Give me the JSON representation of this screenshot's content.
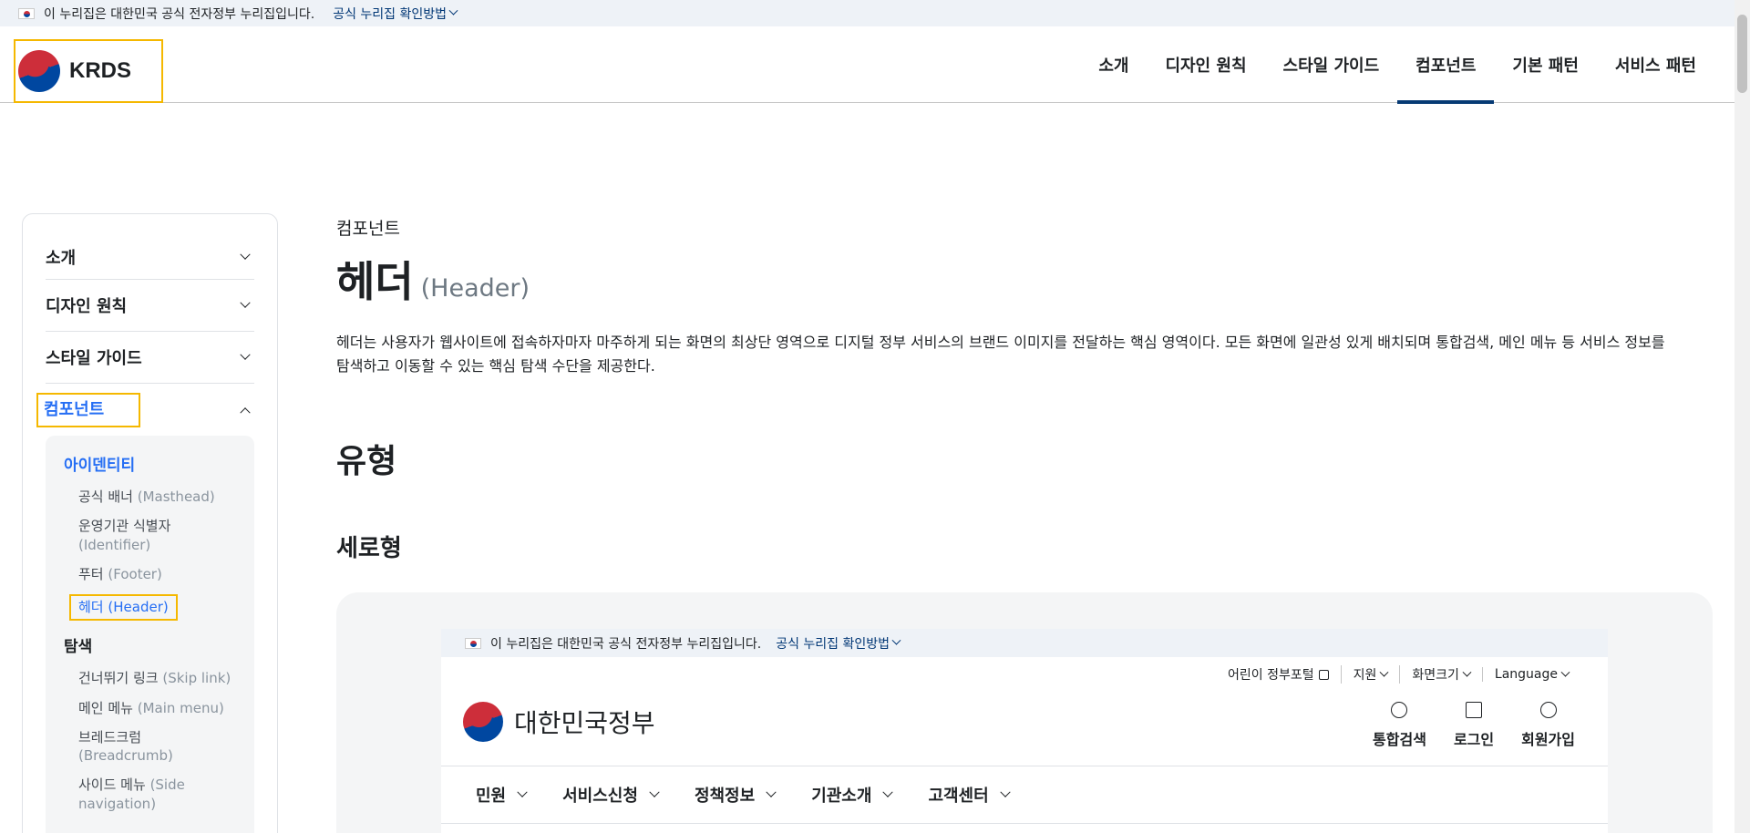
{
  "masthead": {
    "text": "이 누리집은 대한민국 공식 전자정부 누리집입니다.",
    "link": "공식 누리집 확인방법"
  },
  "header": {
    "logo_text": "KRDS",
    "nav": [
      "소개",
      "디자인 원칙",
      "스타일 가이드",
      "컴포넌트",
      "기본 패턴",
      "서비스 패턴"
    ],
    "active_nav": "컴포넌트"
  },
  "sidebar": {
    "sections": [
      "소개",
      "디자인 원칙",
      "스타일 가이드",
      "컴포넌트"
    ],
    "group1": "아이덴티티",
    "identity_items": [
      {
        "ko": "공식 배너",
        "en": "(Masthead)"
      },
      {
        "ko": "운영기관 식별자",
        "en": "(Identifier)"
      },
      {
        "ko": "푸터",
        "en": "(Footer)"
      },
      {
        "ko": "헤더",
        "en": "(Header)"
      }
    ],
    "group2": "탐색",
    "nav_items": [
      {
        "ko": "건너뛰기 링크",
        "en": "(Skip link)"
      },
      {
        "ko": "메인 메뉴",
        "en": "(Main menu)"
      },
      {
        "ko": "브레드크럼",
        "en": "(Breadcrumb)"
      },
      {
        "ko": "사이드 메뉴",
        "en": "(Side navigation)"
      }
    ]
  },
  "main": {
    "breadcrumb": "컴포넌트",
    "title": "헤더",
    "title_en": "(Header)",
    "description": "헤더는 사용자가 웹사이트에 접속하자마자 마주하게 되는 화면의 최상단 영역으로 디지털 정부 서비스의 브랜드 이미지를 전달하는 핵심 영역이다. 모든 화면에 일관성 있게 배치되며 통합검색, 메인 메뉴 등 서비스 정보를 탐색하고 이동할 수 있는 핵심 탐색 수단을 제공한다.",
    "h2": "유형",
    "h3": "세로형"
  },
  "preview": {
    "masthead_text": "이 누리집은 대한민국 공식 전자정부 누리집입니다.",
    "masthead_link": "공식 누리집 확인방법",
    "util": [
      "어린이 정부포털",
      "지원",
      "화면크기",
      "Language"
    ],
    "logo_name": "대한민국정부",
    "actions": [
      "통합검색",
      "로그인",
      "회원가입"
    ],
    "nav": [
      "민원",
      "서비스신청",
      "정책정보",
      "기관소개",
      "고객센터"
    ]
  },
  "colors": {
    "accent": "#256ef4",
    "highlight_border": "#f5b800",
    "active_underline": "#063a74"
  }
}
